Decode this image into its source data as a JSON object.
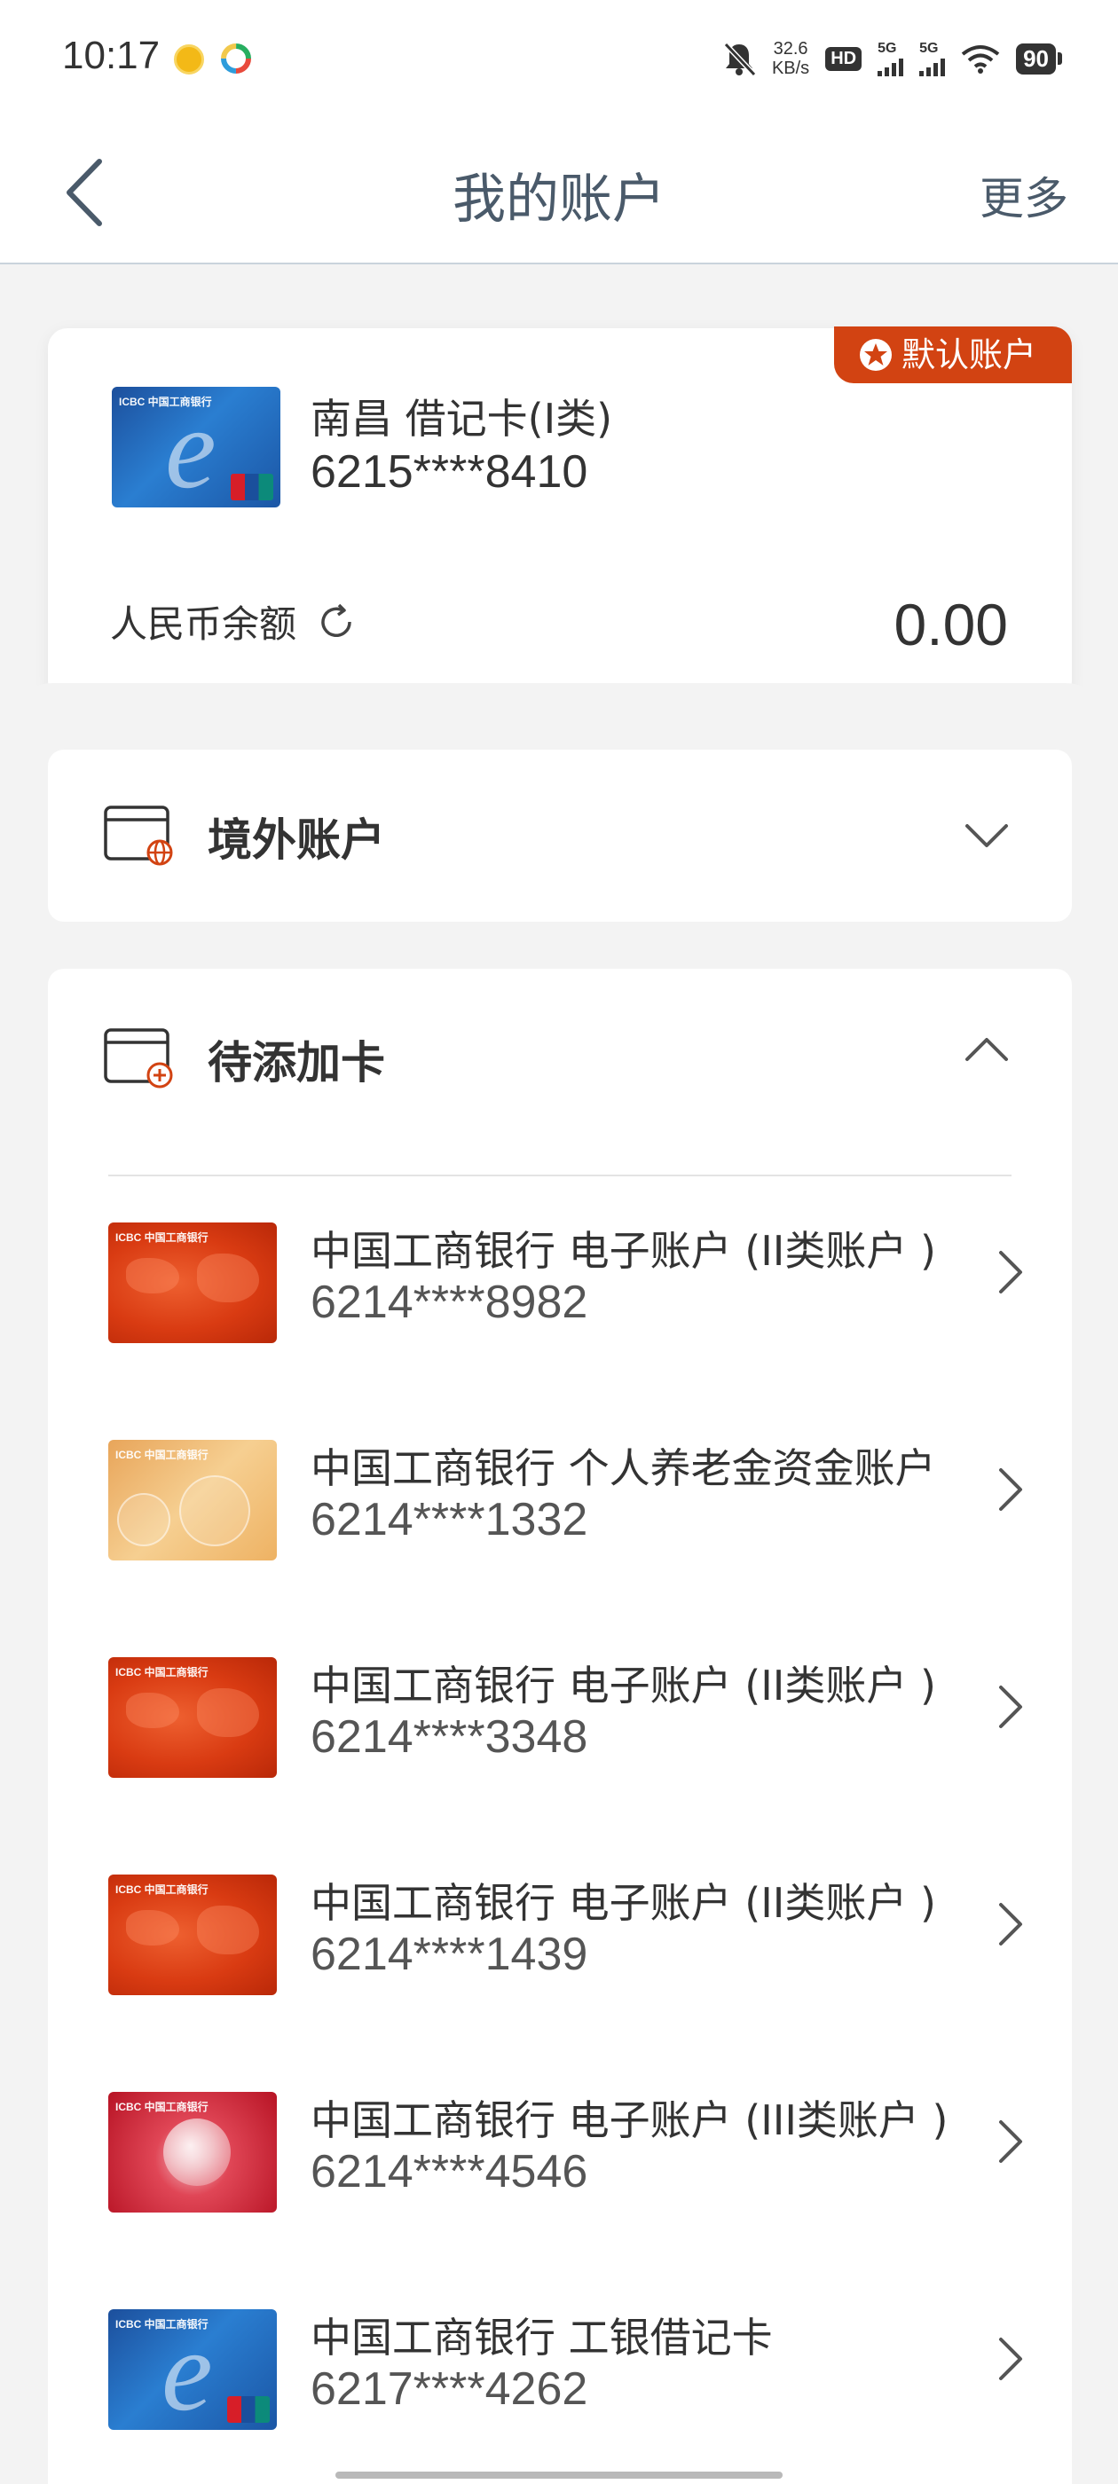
{
  "status_bar": {
    "time": "10:17",
    "net_speed_value": "32.6",
    "net_speed_unit": "KB/s",
    "hd_label": "HD",
    "sim1_label": "5G",
    "sim2_label": "5G",
    "battery": "90"
  },
  "header": {
    "title": "我的账户",
    "more_label": "更多"
  },
  "default_account": {
    "badge": "默认账户",
    "card_name": "南昌 借记卡(Ⅰ类)",
    "card_number": "6215****8410",
    "balance_label": "人民币余额",
    "balance_value": "0.00"
  },
  "sections": {
    "overseas": {
      "title": "境外账户"
    },
    "pending": {
      "title": "待添加卡"
    }
  },
  "pending_cards": [
    {
      "name": "中国工商银行  电子账户 (II类账户 )",
      "number": "6214****8982",
      "style": "red"
    },
    {
      "name": "中国工商银行  个人养老金资金账户",
      "number": "6214****1332",
      "style": "orange"
    },
    {
      "name": "中国工商银行  电子账户 (II类账户 )",
      "number": "6214****3348",
      "style": "red"
    },
    {
      "name": "中国工商银行  电子账户 (II类账户 )",
      "number": "6214****1439",
      "style": "red"
    },
    {
      "name": "中国工商银行  电子账户 (III类账户 )",
      "number": "6214****4546",
      "style": "crimson"
    },
    {
      "name": "中国工商银行  工银借记卡",
      "number": "6217****4262",
      "style": "blue"
    }
  ],
  "card_logo_text": "ICBC 中国工商银行",
  "colors": {
    "accent": "#d24312",
    "title_text": "#4a5a6a",
    "background": "#f3f3f3"
  }
}
